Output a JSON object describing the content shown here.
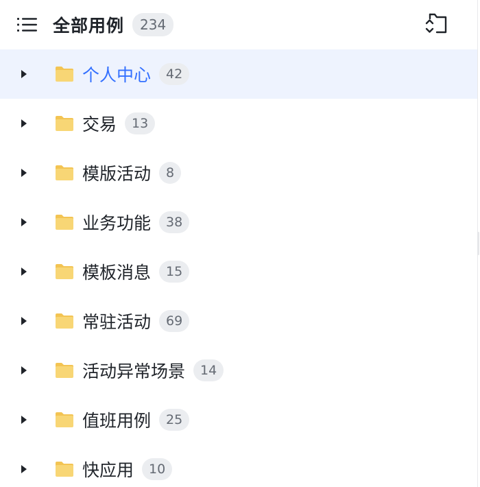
{
  "header": {
    "title": "全部用例",
    "count": "234",
    "menu_icon": "list-icon",
    "action_icon": "folder-sort-icon"
  },
  "colors": {
    "accent": "#3370ff",
    "active_bg": "#eef3fe",
    "badge_bg": "#ebedf0",
    "folder": "#f8d675"
  },
  "folders": [
    {
      "label": "个人中心",
      "count": "42",
      "active": true
    },
    {
      "label": "交易",
      "count": "13",
      "active": false
    },
    {
      "label": "模版活动",
      "count": "8",
      "active": false
    },
    {
      "label": "业务功能",
      "count": "38",
      "active": false
    },
    {
      "label": "模板消息",
      "count": "15",
      "active": false
    },
    {
      "label": "常驻活动",
      "count": "69",
      "active": false
    },
    {
      "label": "活动异常场景",
      "count": "14",
      "active": false
    },
    {
      "label": "值班用例",
      "count": "25",
      "active": false
    },
    {
      "label": "快应用",
      "count": "10",
      "active": false
    }
  ]
}
